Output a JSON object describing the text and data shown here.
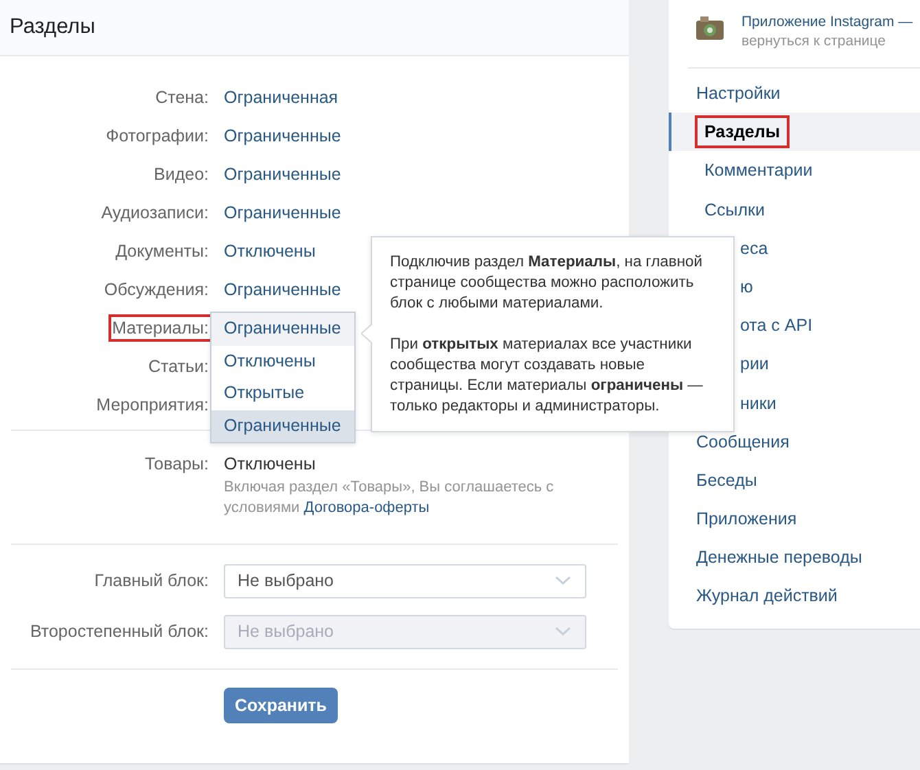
{
  "header": {
    "title": "Разделы"
  },
  "settings": [
    {
      "label": "Стена:",
      "value": "Ограниченная"
    },
    {
      "label": "Фотографии:",
      "value": "Ограниченные"
    },
    {
      "label": "Видео:",
      "value": "Ограниченные"
    },
    {
      "label": "Аудиозаписи:",
      "value": "Ограниченные"
    },
    {
      "label": "Документы:",
      "value": "Отключены"
    },
    {
      "label": "Обсуждения:",
      "value": "Ограниченные"
    },
    {
      "label": "Материалы:",
      "highlighted": true,
      "dropdown": {
        "options": [
          {
            "label": "Ограниченные",
            "hovered": true,
            "selected": false
          },
          {
            "label": "Отключены",
            "hovered": false,
            "selected": false
          },
          {
            "label": "Открытые",
            "hovered": false,
            "selected": false
          },
          {
            "label": "Ограниченные",
            "hovered": false,
            "selected": true
          }
        ]
      }
    },
    {
      "label": "Статьи:"
    },
    {
      "label": "Мероприятия:"
    }
  ],
  "tooltip": {
    "paragraphs": [
      "Подключив раздел **Материалы**, на главной странице сообщества можно расположить блок с любыми материалами.",
      "При **открытых** материалах все участники сообщества могут создавать новые страницы. Если материалы **ограничены** — только редакторы и администраторы."
    ]
  },
  "goods": {
    "label": "Товары:",
    "value": "Отключены",
    "hint": "Включая раздел «Товары», Вы соглашаетесь с условиями",
    "hint_link": "Договора-оферты"
  },
  "blocks": [
    {
      "label": "Главный блок:",
      "value": "Не выбрано",
      "disabled": false
    },
    {
      "label": "Второстепенный блок:",
      "value": "Не выбрано",
      "disabled": true
    }
  ],
  "save_button": "Сохранить",
  "sidebar": {
    "app": {
      "title": "Приложение Instagram —",
      "subtitle": "вернуться к странице"
    },
    "items": [
      {
        "label": "Настройки",
        "selected": false,
        "covered": false,
        "children": [
          {
            "label": "Разделы",
            "selected": true,
            "highlighted": true,
            "covered": false
          },
          {
            "label": "Комментарии",
            "selected": false,
            "covered": false
          },
          {
            "label": "Ссылки",
            "selected": false,
            "covered": false
          },
          {
            "label": "еса",
            "selected": false,
            "covered": true
          },
          {
            "label": "ю",
            "selected": false,
            "covered": true
          },
          {
            "label": "ота с API",
            "selected": false,
            "covered": true
          },
          {
            "label": "рии",
            "selected": false,
            "covered": true
          },
          {
            "label": "ники",
            "selected": false,
            "covered": true
          }
        ]
      },
      {
        "label": "Сообщения",
        "selected": false,
        "covered": false
      },
      {
        "label": "Беседы",
        "selected": false,
        "covered": false
      },
      {
        "label": "Приложения",
        "selected": false,
        "covered": false
      },
      {
        "label": "Денежные переводы",
        "selected": false,
        "covered": false
      },
      {
        "label": "Журнал действий",
        "selected": false,
        "covered": false
      }
    ]
  }
}
